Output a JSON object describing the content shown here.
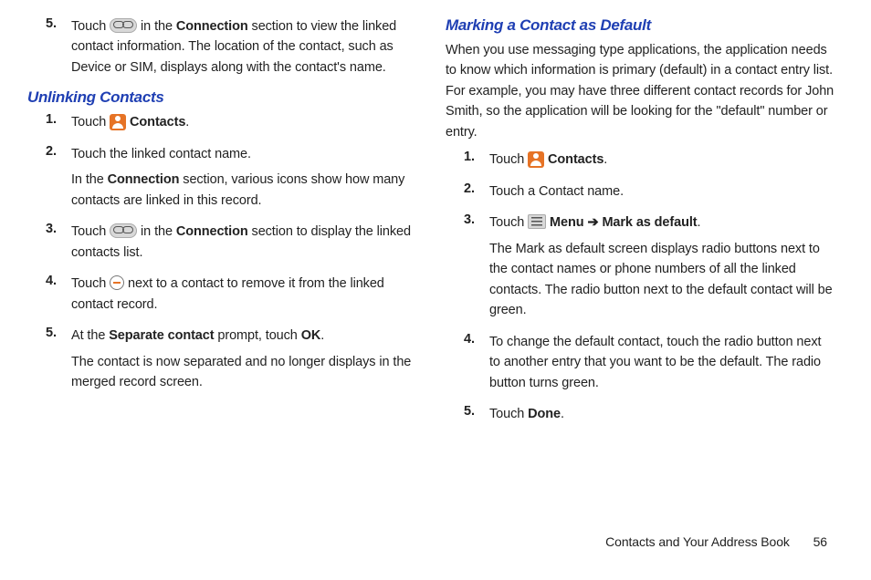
{
  "left": {
    "step5intro": {
      "num": "5.",
      "t1": "Touch ",
      "t2": " in the ",
      "b2": "Connection",
      "t3": " section to view the linked contact information. The location of the contact, such as Device or SIM, displays along with the contact's name."
    },
    "heading": "Unlinking Contacts",
    "steps": [
      {
        "num": "1.",
        "t1": "Touch ",
        "b1": " Contacts",
        "t2": "."
      },
      {
        "num": "2.",
        "t1": "Touch the linked contact name.",
        "p2a": "In the ",
        "p2b": "Connection",
        "p2c": " section, various icons show how many contacts are linked in this record."
      },
      {
        "num": "3.",
        "t1": "Touch ",
        "t2": " in the ",
        "b2": "Connection",
        "t3": " section to display the linked contacts list."
      },
      {
        "num": "4.",
        "t1": "Touch ",
        "t2": " next to a contact to remove it from the linked contact record."
      },
      {
        "num": "5.",
        "t1": "At the ",
        "b1": "Separate contact",
        "t2": " prompt, touch ",
        "b2": "OK",
        "t3": ".",
        "p2": "The contact is now separated and no longer displays in the merged record screen."
      }
    ]
  },
  "right": {
    "heading": "Marking a Contact as Default",
    "intro": "When you use messaging type applications, the application needs to know which information is primary (default) in a contact entry list. For example, you may have three different contact records for John Smith, so the application will be looking for the \"default\" number or entry.",
    "steps": [
      {
        "num": "1.",
        "t1": "Touch ",
        "b1": " Contacts",
        "t2": "."
      },
      {
        "num": "2.",
        "t1": "Touch a Contact name."
      },
      {
        "num": "3.",
        "t1": "Touch ",
        "b1": " Menu",
        "arrow": " ➔ ",
        "b2": "Mark as default",
        "t2": ".",
        "p2": "The Mark as default screen displays radio buttons next to the contact names or phone numbers of all the linked contacts. The radio button next to the default contact will be green."
      },
      {
        "num": "4.",
        "t1": "To change the default contact, touch the radio button next to another entry that you want to be the default. The radio button turns green."
      },
      {
        "num": "5.",
        "t1": "Touch ",
        "b1": "Done",
        "t2": "."
      }
    ]
  },
  "footer": {
    "label": "Contacts and Your Address Book",
    "page": "56"
  }
}
